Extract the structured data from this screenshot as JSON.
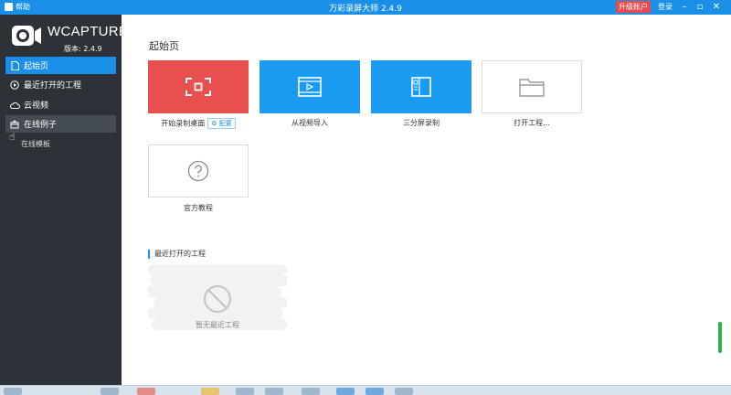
{
  "titlebar": {
    "help_label": "帮助",
    "title": "万彩录屏大师 2.4.9",
    "upgrade_label": "升级账户",
    "login_label": "登录"
  },
  "sidebar": {
    "brand": "WCAPTURE",
    "version": "版本: 2.4.9",
    "items": [
      {
        "label": "起始页",
        "icon": "page-icon",
        "active": true
      },
      {
        "label": "最近打开的工程",
        "icon": "play-circle-icon"
      },
      {
        "label": "云视频",
        "icon": "cloud-icon"
      },
      {
        "label": "在线例子",
        "icon": "gift-icon",
        "hover": true
      }
    ],
    "sub_item": "在线模板"
  },
  "main": {
    "section_title": "起始页",
    "tiles": [
      {
        "label": "开始录制桌面",
        "icon": "record-screen-icon",
        "color": "#ea4f4f",
        "badge": "配置"
      },
      {
        "label": "从视频导入",
        "icon": "film-icon",
        "color": "#1a9af0"
      },
      {
        "label": "三分屏录制",
        "icon": "split-screen-icon",
        "color": "#1a9af0"
      },
      {
        "label": "打开工程...",
        "icon": "folder-icon",
        "color": "#ffffff"
      },
      {
        "label": "官方教程",
        "icon": "question-icon",
        "color": "#ffffff"
      }
    ],
    "recent_title": "最近打开的工程",
    "empty_text": "暂无最近工程"
  },
  "colors": {
    "accent": "#1a8fe8",
    "sidebar_bg": "#2c3237",
    "record_red": "#ea4f4f",
    "upgrade_red": "#e94a4a"
  }
}
